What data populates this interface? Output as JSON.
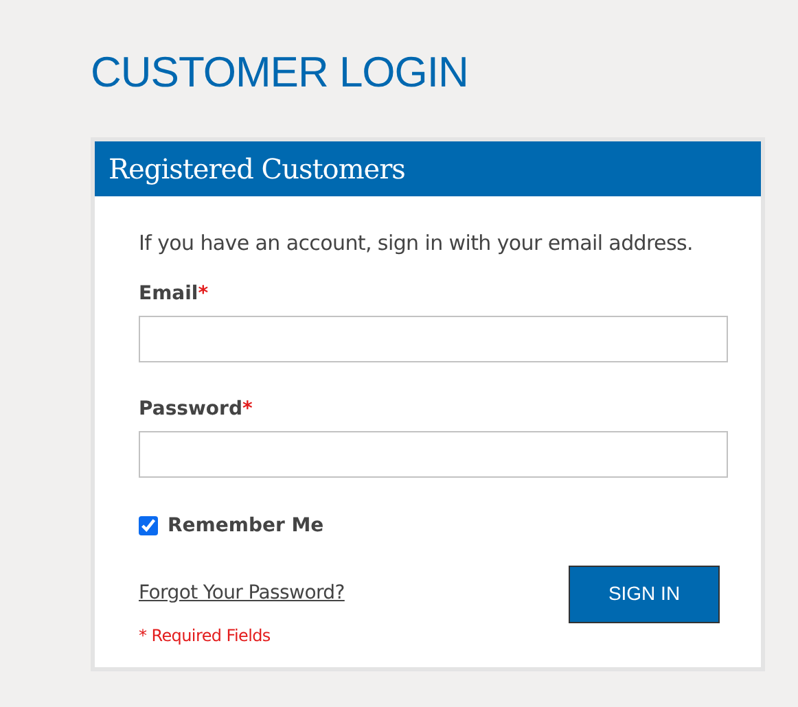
{
  "page_title": "CUSTOMER LOGIN",
  "card": {
    "title": "Registered Customers",
    "intro": "If you have an account, sign in with your email address.",
    "fields": [
      {
        "label": "Email",
        "required_mark": "*"
      },
      {
        "label": "Password",
        "required_mark": "*"
      }
    ],
    "remember": {
      "label": "Remember Me",
      "checked": true
    },
    "forgot_link": "Forgot Your Password?",
    "submit": "SIGN IN",
    "required_note": "* Required Fields"
  }
}
